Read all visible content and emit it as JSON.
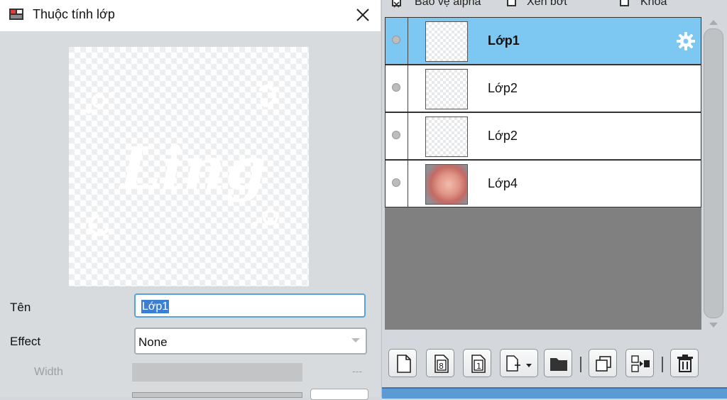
{
  "dialog": {
    "title": "Thuộc tính lớp",
    "preview_text": "Ling",
    "name_label": "Tên",
    "name_value": "Lớp1",
    "effect_label": "Effect",
    "effect_value": "None",
    "width_label": "Width",
    "width_value": "---"
  },
  "layers_panel": {
    "options": [
      {
        "label": "Bảo vệ alpha",
        "checked": true
      },
      {
        "label": "Xén bớt",
        "checked": false
      },
      {
        "label": "Khóa",
        "checked": false
      }
    ],
    "layers": [
      {
        "name": "Lớp1",
        "selected": true,
        "thumbnail": "transparent-text"
      },
      {
        "name": "Lớp2",
        "selected": false,
        "thumbnail": "transparent"
      },
      {
        "name": "Lớp2",
        "selected": false,
        "thumbnail": "transparent"
      },
      {
        "name": "Lớp4",
        "selected": false,
        "thumbnail": "photo"
      }
    ],
    "selected_color": "#7cc8f2",
    "toolbar": [
      "new-layer-icon",
      "new-8bit-layer-icon",
      "new-1bit-layer-icon",
      "add-layer-dropdown-icon",
      "folder-icon",
      "duplicate-layer-icon",
      "merge-down-icon",
      "delete-layer-icon"
    ]
  }
}
